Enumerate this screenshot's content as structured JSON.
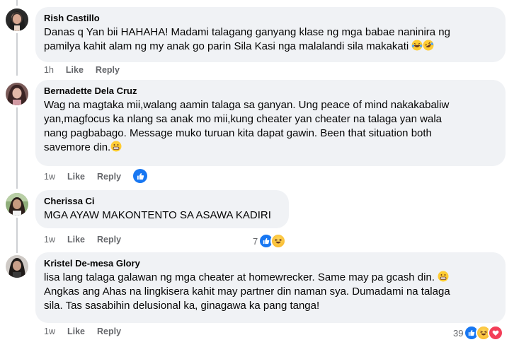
{
  "comments": [
    {
      "author": "Rish Castillo",
      "lines": [
        "Danas q Yan bii HAHAHA! Madami talagang ganyang klase ng mga babae naninira ng",
        "pamilya kahit alam ng my anak go parin Sila Kasi nga malalandi sila makakati"
      ],
      "time": "1h",
      "like": "Like",
      "reply": "Reply",
      "emojis": [
        "laughing-tears-icon",
        "rolling-laughing-icon"
      ]
    },
    {
      "author": "Bernadette Dela Cruz",
      "lines": [
        "Wag na magtaka mii,walang aamin talaga sa ganyan. Ung peace of mind nakakabaliw",
        "yan,magfocus ka nlang sa anak mo mii,kung cheater yan cheater na talaga yan wala",
        "nang pagbabago. Message muko turuan kita dapat gawin. Been that situation both",
        "savemore din."
      ],
      "time": "1w",
      "like": "Like",
      "reply": "Reply",
      "reactions": [
        "like"
      ],
      "emojis": [
        "grimacing-icon"
      ]
    },
    {
      "author": "Cherissa Ci",
      "lines": [
        "MGA AYAW MAKONTENTO SA ASAWA KADIRI"
      ],
      "time": "1w",
      "like": "Like",
      "reply": "Reply",
      "reaction_count": "7",
      "reactions": [
        "like",
        "haha"
      ]
    },
    {
      "author": "Kristel De-mesa Glory",
      "lines": [
        "lisa lang talaga galawan ng mga cheater at homewrecker. Same may pa gcash din.",
        "Angkas ang Ahas na lingkisera kahit may partner din naman sya. Dumadami na talaga",
        "sila. Tas sasabihin delusional ka, ginagawa ka pang tanga!"
      ],
      "time": "1w",
      "like": "Like",
      "reply": "Reply",
      "reaction_count": "39",
      "reactions": [
        "like",
        "haha",
        "love"
      ],
      "emojis": [
        "grimacing-icon"
      ]
    }
  ],
  "colors": {
    "bubble": "#f0f2f5",
    "meta": "#65676b",
    "like_blue": "#1877f2",
    "love_red": "#f33e58"
  }
}
